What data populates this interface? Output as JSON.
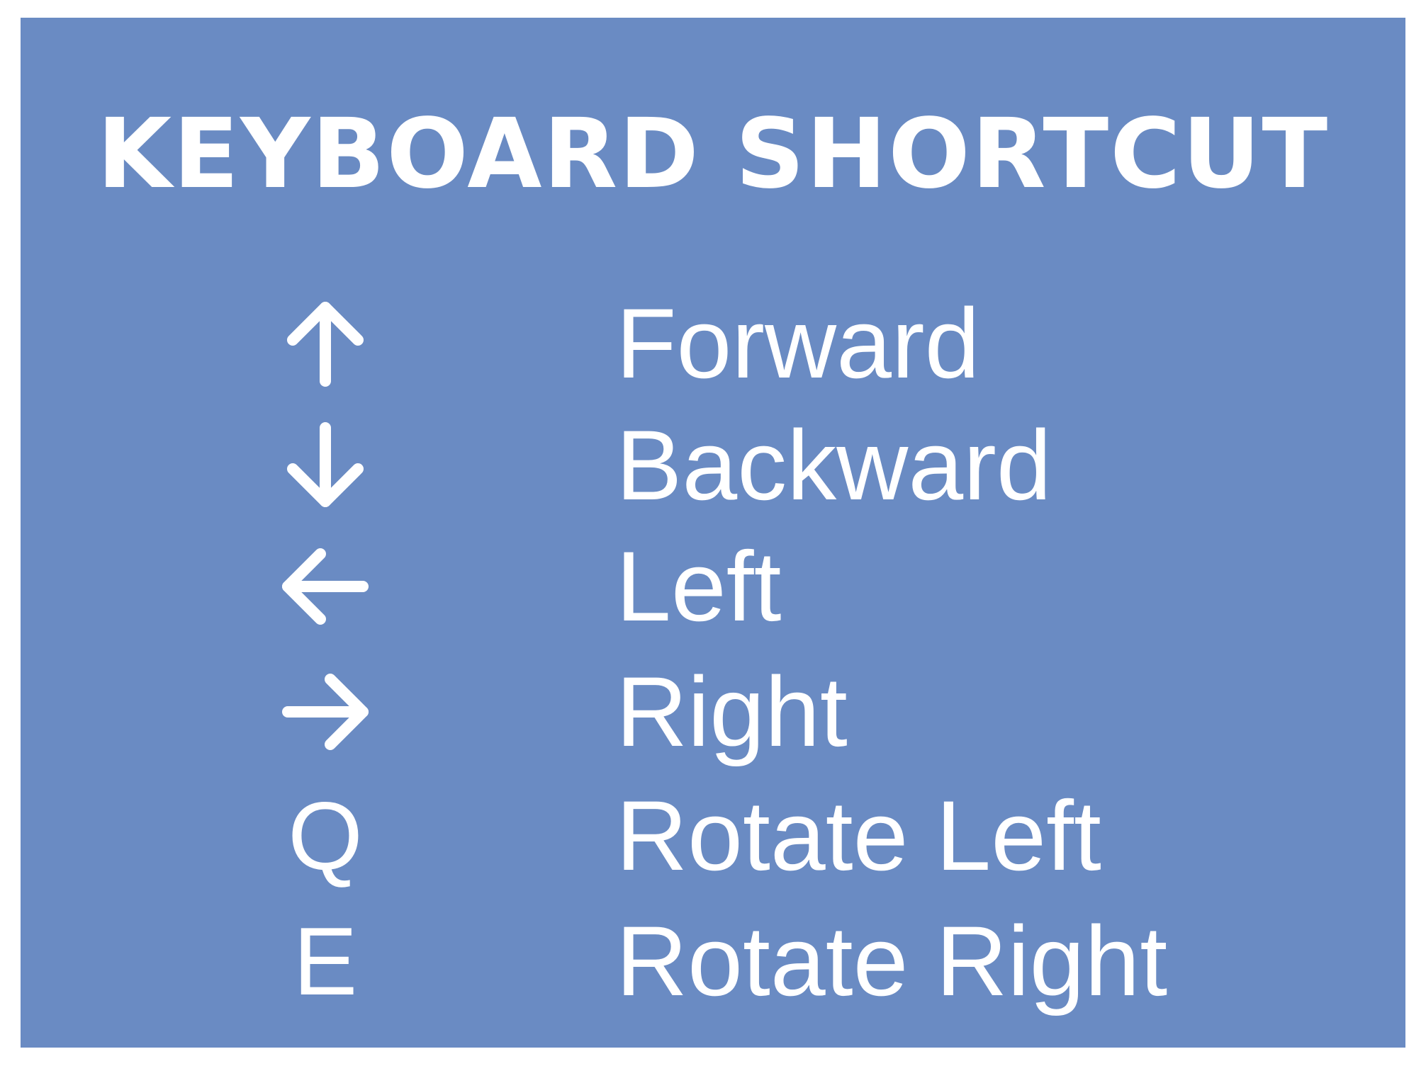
{
  "title": "KEYBOARD SHORTCUT",
  "colors": {
    "panel_background": "#6a8bc3",
    "page_background": "#ffffff",
    "text": "#ffffff"
  },
  "shortcuts": [
    {
      "key_icon": "arrow-up-icon",
      "action": "Forward"
    },
    {
      "key_icon": "arrow-down-icon",
      "action": "Backward"
    },
    {
      "key_icon": "arrow-left-icon",
      "action": "Left"
    },
    {
      "key_icon": "arrow-right-icon",
      "action": "Right"
    },
    {
      "key": "Q",
      "action": "Rotate Left"
    },
    {
      "key": "E",
      "action": "Rotate Right"
    }
  ]
}
